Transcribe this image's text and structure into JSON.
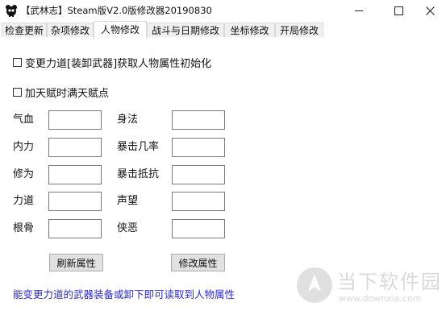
{
  "window": {
    "title": "【武林志】Steam版V2.0版修改器20190830",
    "icon": "panda-app-icon"
  },
  "tabs": [
    {
      "label": "检查更新",
      "active": false
    },
    {
      "label": "杂项修改",
      "active": false
    },
    {
      "label": "人物修改",
      "active": true
    },
    {
      "label": "战斗与日期修改",
      "active": false
    },
    {
      "label": "坐标修改",
      "active": false
    },
    {
      "label": "开局修改",
      "active": false
    }
  ],
  "checkboxes": {
    "equip_init": {
      "label": "变更力道[装卸武器]获取人物属性初始化",
      "checked": false
    },
    "talent_full": {
      "label": "加天赋时满天赋点",
      "checked": false
    }
  },
  "fields_left": [
    {
      "label": "气血",
      "value": ""
    },
    {
      "label": "内力",
      "value": ""
    },
    {
      "label": "修为",
      "value": ""
    },
    {
      "label": "力道",
      "value": ""
    },
    {
      "label": "根骨",
      "value": ""
    }
  ],
  "fields_right": [
    {
      "label": "身法",
      "value": ""
    },
    {
      "label": "暴击几率",
      "value": ""
    },
    {
      "label": "暴击抵抗",
      "value": ""
    },
    {
      "label": "声望",
      "value": ""
    },
    {
      "label": "侠恶",
      "value": ""
    }
  ],
  "buttons": {
    "refresh": "刷新属性",
    "modify": "修改属性"
  },
  "hint": "能变更力道的武器装备或卸下即可读取到人物属性",
  "watermark": {
    "brand": "当下软件园",
    "url": "www.downxia.com"
  }
}
